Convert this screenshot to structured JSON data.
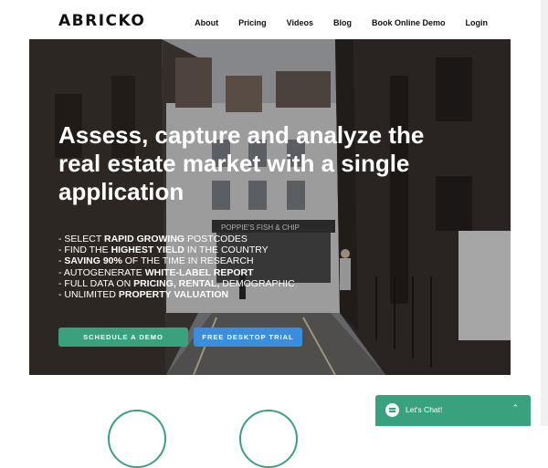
{
  "brand": {
    "logo": "ABRICKO"
  },
  "nav": {
    "items": [
      "About",
      "Pricing",
      "Videos",
      "Blog",
      "Book Online Demo",
      "Login"
    ]
  },
  "hero": {
    "headline": [
      "Assess, capture and analyze the",
      "real estate market with a single",
      "application"
    ],
    "bullets": [
      {
        "pre": "- SELECT ",
        "bold": "RAPID GROWING",
        "post": " POSTCODES"
      },
      {
        "pre": "- FIND THE ",
        "bold": "HIGHEST YIELD",
        "post": " IN THE COUNTRY"
      },
      {
        "pre": "- ",
        "bold": "SAVING 90%",
        "post": " OF  THE TIME IN RESEARCH"
      },
      {
        "pre": "- AUTOGENERATE ",
        "bold": "WHITE-LABEL REPORT",
        "post": ""
      },
      {
        "pre": "- FULL DATA ON ",
        "bold": "PRICING, RENTAL,",
        "post": " DEMOGRAPHIC"
      },
      {
        "pre": "- UNLIMITED ",
        "bold": "PROPERTY VALUATION",
        "post": ""
      }
    ],
    "buttons": {
      "demo": "SCHEDULE A DEMO",
      "trial": "FREE DESKTOP TRIAL"
    },
    "shop_sign": "POPPIE'S FISH & CHIP",
    "colors": {
      "demo": "#3aa17e",
      "trial": "#3b8ede"
    }
  },
  "chat": {
    "label": "Let's Chat!",
    "icon": "chat-bubble-icon",
    "chevron": "chevron-up-icon"
  }
}
